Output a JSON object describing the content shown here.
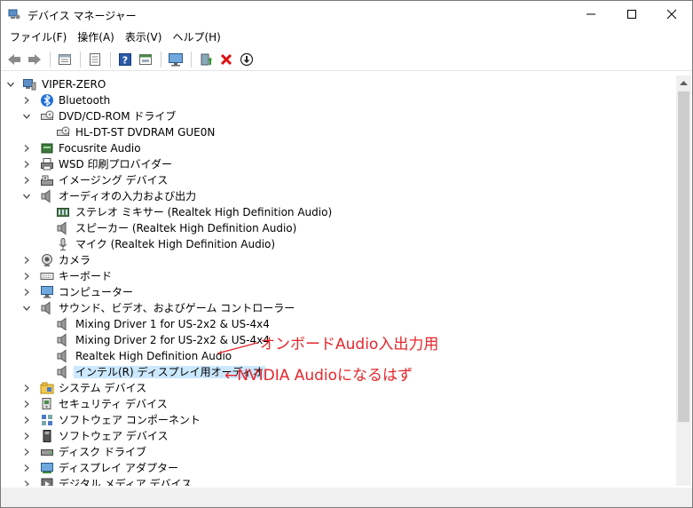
{
  "window": {
    "title": "デバイス マネージャー"
  },
  "menu": [
    {
      "label": "ファイル(F)"
    },
    {
      "label": "操作(A)"
    },
    {
      "label": "表示(V)"
    },
    {
      "label": "ヘルプ(H)"
    }
  ],
  "toolbar": [
    "back-icon",
    "forward-icon",
    "sep",
    "properties-icon",
    "sep",
    "view-icon",
    "sep",
    "help-icon",
    "show-hidden-icon",
    "sep",
    "monitor-icon",
    "sep",
    "update-driver-icon",
    "uninstall-icon",
    "download-icon"
  ],
  "tree": [
    {
      "label": "VIPER-ZERO",
      "level": 0,
      "expander": "open",
      "icon": "computer-icon"
    },
    {
      "label": "Bluetooth",
      "level": 1,
      "expander": "closed",
      "icon": "bluetooth-icon"
    },
    {
      "label": "DVD/CD-ROM ドライブ",
      "level": 1,
      "expander": "open",
      "icon": "dvd-drive-icon"
    },
    {
      "label": "HL-DT-ST DVDRAM GUE0N",
      "level": 2,
      "expander": "none",
      "icon": "dvd-drive-icon"
    },
    {
      "label": "Focusrite Audio",
      "level": 1,
      "expander": "closed",
      "icon": "audio-device-icon"
    },
    {
      "label": "WSD 印刷プロバイダー",
      "level": 1,
      "expander": "closed",
      "icon": "printer-icon"
    },
    {
      "label": "イメージング デバイス",
      "level": 1,
      "expander": "closed",
      "icon": "scanner-icon"
    },
    {
      "label": "オーディオの入力および出力",
      "level": 1,
      "expander": "open",
      "icon": "speaker-icon"
    },
    {
      "label": "ステレオ ミキサー (Realtek High Definition Audio)",
      "level": 2,
      "expander": "none",
      "icon": "mixer-icon"
    },
    {
      "label": "スピーカー (Realtek High Definition Audio)",
      "level": 2,
      "expander": "none",
      "icon": "speaker-icon"
    },
    {
      "label": "マイク (Realtek High Definition Audio)",
      "level": 2,
      "expander": "none",
      "icon": "microphone-icon"
    },
    {
      "label": "カメラ",
      "level": 1,
      "expander": "closed",
      "icon": "camera-icon"
    },
    {
      "label": "キーボード",
      "level": 1,
      "expander": "closed",
      "icon": "keyboard-icon"
    },
    {
      "label": "コンピューター",
      "level": 1,
      "expander": "closed",
      "icon": "monitor-icon"
    },
    {
      "label": "サウンド、ビデオ、およびゲーム コントローラー",
      "level": 1,
      "expander": "open",
      "icon": "speaker-icon"
    },
    {
      "label": "Mixing Driver 1 for US-2x2 & US-4x4",
      "level": 2,
      "expander": "none",
      "icon": "speaker-icon"
    },
    {
      "label": "Mixing Driver 2 for US-2x2 & US-4x4",
      "level": 2,
      "expander": "none",
      "icon": "speaker-icon"
    },
    {
      "label": "Realtek High Definition Audio",
      "level": 2,
      "expander": "none",
      "icon": "speaker-icon"
    },
    {
      "label": "インテル(R) ディスプレイ用オーディオ",
      "level": 2,
      "expander": "none",
      "icon": "speaker-icon",
      "selected": true
    },
    {
      "label": "システム デバイス",
      "level": 1,
      "expander": "closed",
      "icon": "system-folder-icon"
    },
    {
      "label": "セキュリティ デバイス",
      "level": 1,
      "expander": "closed",
      "icon": "security-device-icon"
    },
    {
      "label": "ソフトウェア コンポーネント",
      "level": 1,
      "expander": "closed",
      "icon": "software-component-icon"
    },
    {
      "label": "ソフトウェア デバイス",
      "level": 1,
      "expander": "closed",
      "icon": "software-device-icon"
    },
    {
      "label": "ディスク ドライブ",
      "level": 1,
      "expander": "closed",
      "icon": "disk-drive-icon"
    },
    {
      "label": "ディスプレイ アダプター",
      "level": 1,
      "expander": "closed",
      "icon": "display-adapter-icon"
    },
    {
      "label": "デジタル メディア デバイス",
      "level": 1,
      "expander": "closed",
      "icon": "media-device-icon"
    }
  ],
  "annotations": {
    "onboard": "オンボードAudio入出力用",
    "nvidia": "←NVIDIA Audioになるはず"
  },
  "colors": {
    "annotation": "#e8262b",
    "selection": "#cce8ff"
  }
}
